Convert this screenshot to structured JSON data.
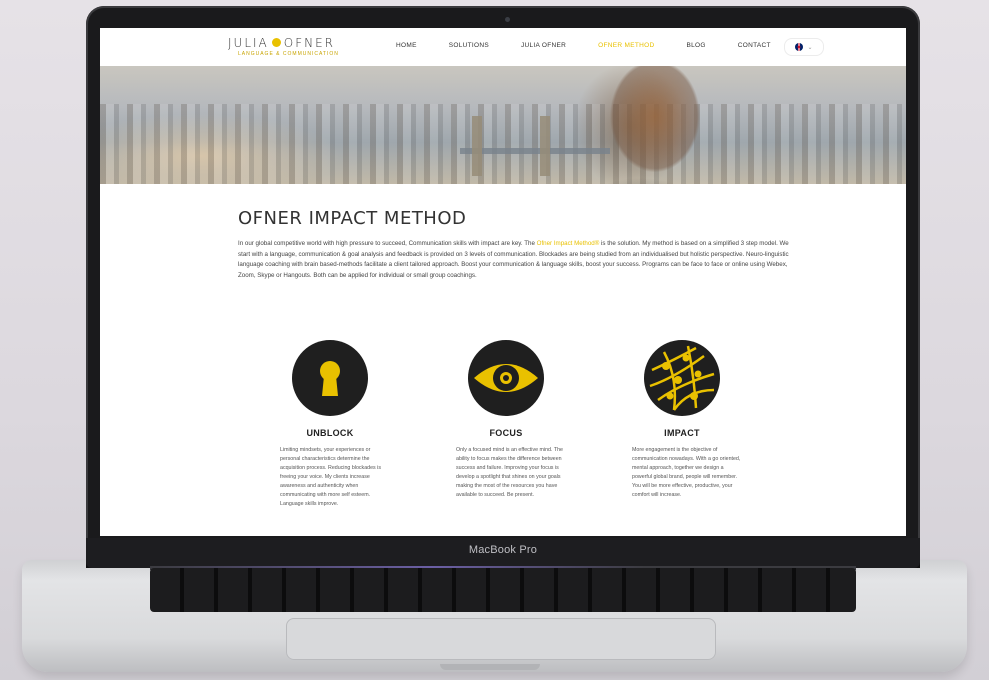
{
  "device": {
    "label": "MacBook Pro"
  },
  "site": {
    "logo": {
      "left": "JULIA",
      "right": "OFNER",
      "tagline": "LANGUAGE & COMMUNICATION"
    },
    "nav": [
      {
        "label": "HOME"
      },
      {
        "label": "SOLUTIONS"
      },
      {
        "label": "JULIA OFNER"
      },
      {
        "label": "OFNER METHOD",
        "active": true
      },
      {
        "label": "BLOG"
      },
      {
        "label": "CONTACT"
      }
    ],
    "language": {
      "flag": "uk-flag-icon",
      "chevron": "chevron-down-icon"
    }
  },
  "page": {
    "title": "OFNER IMPACT METHOD",
    "intro_before": "In our global competitive world with high pressure to succeed, Communication skills with impact are key. The ",
    "intro_link": "Ofner Impact Method®",
    "intro_after": " is the solution. My method is based on a simplified 3 step model. We start with a language, communication & goal analysis and feedback is provided on 3 levels of communication. Blockades are being studied from an individualised but holistic perspective. Neuro-linguistic language coaching with brain based-methods facilitate a client tailored approach. Boost your communication & language skills, boost your success. Programs can be face to face or online using Webex, Zoom, Skype or Hangouts. Both can be applied for individual or small group coachings."
  },
  "features": [
    {
      "icon": "keyhole-icon",
      "title": "UNBLOCK",
      "text": "Limiting mindsets, your experiences or personal characteristics determine the acquisition process. Reducing blockades is freeing your voice. My clients increase awareness and authenticity when communicating with more self esteem. Language skills improve."
    },
    {
      "icon": "eye-icon",
      "title": "FOCUS",
      "text": "Only a focused mind is an effective mind. The ability to focus makes the difference between success and failure. Improving your focus is develop a spotlight that shines on your goals making the most of the resources you have available to succeed. Be present."
    },
    {
      "icon": "network-globe-icon",
      "title": "IMPACT",
      "text": "More engagement is the objective of communication nowadays. With a go oriented, mental approach, together we design a powerful global brand, people will remember. You will be more effective, productive, your comfort will increase."
    }
  ],
  "colors": {
    "accent": "#e9c100",
    "dark": "#1f1f1f"
  }
}
